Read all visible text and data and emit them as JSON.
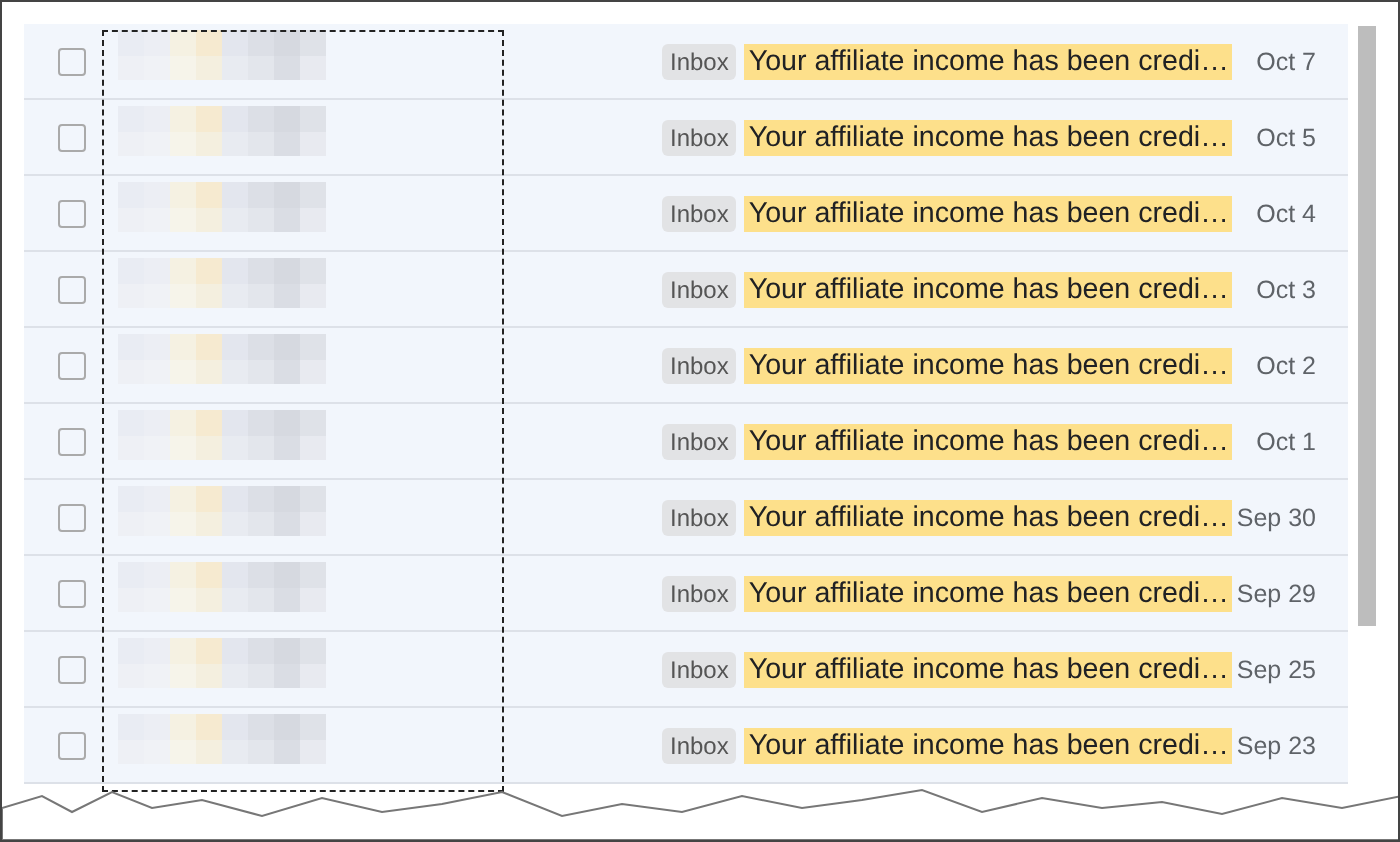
{
  "emails": [
    {
      "label": "Inbox",
      "subject": "Your affiliate income has been credi…",
      "date": "Oct 7",
      "checked": false
    },
    {
      "label": "Inbox",
      "subject": "Your affiliate income has been credi…",
      "date": "Oct 5",
      "checked": false
    },
    {
      "label": "Inbox",
      "subject": "Your affiliate income has been credi…",
      "date": "Oct 4",
      "checked": false
    },
    {
      "label": "Inbox",
      "subject": "Your affiliate income has been credi…",
      "date": "Oct 3",
      "checked": false
    },
    {
      "label": "Inbox",
      "subject": "Your affiliate income has been credi…",
      "date": "Oct 2",
      "checked": false
    },
    {
      "label": "Inbox",
      "subject": "Your affiliate income has been credi…",
      "date": "Oct 1",
      "checked": false
    },
    {
      "label": "Inbox",
      "subject": "Your affiliate income has been credi…",
      "date": "Sep 30",
      "checked": false
    },
    {
      "label": "Inbox",
      "subject": "Your affiliate income has been credi…",
      "date": "Sep 29",
      "checked": false
    },
    {
      "label": "Inbox",
      "subject": "Your affiliate income has been credi…",
      "date": "Sep 25",
      "checked": false
    },
    {
      "label": "Inbox",
      "subject": "Your affiliate income has been credi…",
      "date": "Sep 23",
      "checked": false
    }
  ]
}
